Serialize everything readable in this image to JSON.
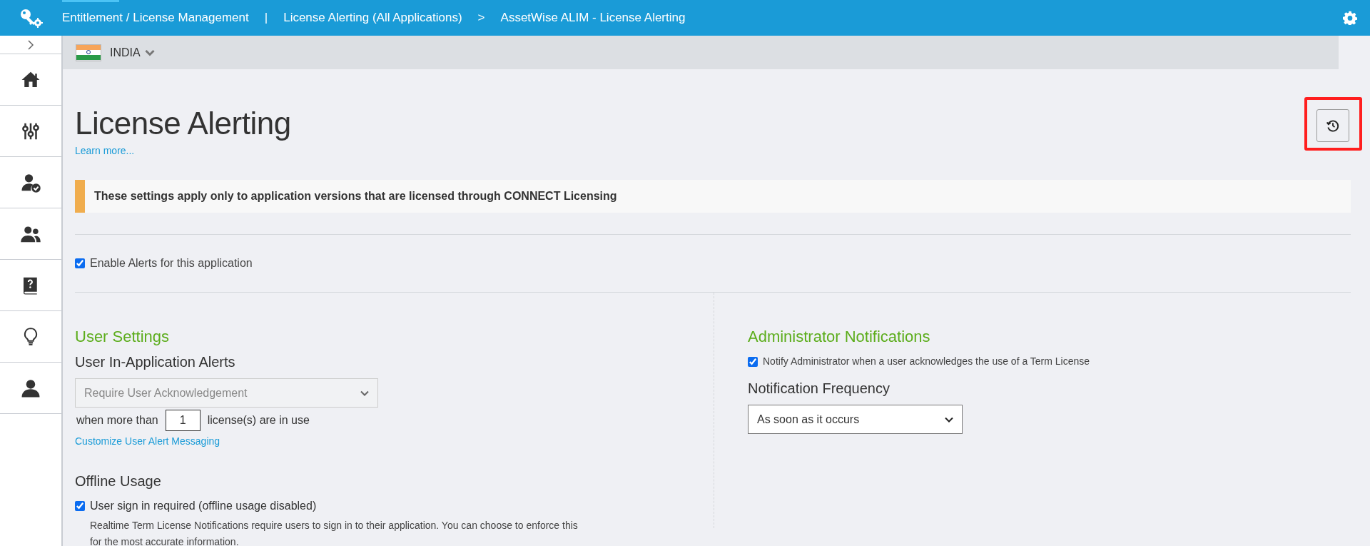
{
  "header": {
    "breadcrumbs": [
      "Entitlement / License Management",
      "License Alerting (All Applications)",
      "AssetWise ALIM - License Alerting"
    ],
    "separators": [
      "|",
      ">"
    ]
  },
  "sidebar": {
    "items": [
      {
        "kind": "home",
        "selected": false
      },
      {
        "kind": "sliders",
        "selected": false
      },
      {
        "kind": "user-check",
        "selected": false
      },
      {
        "kind": "users",
        "selected": false
      },
      {
        "kind": "help-book",
        "selected": false
      },
      {
        "kind": "bulb",
        "selected": false
      },
      {
        "kind": "user",
        "selected": false
      }
    ]
  },
  "country": {
    "name": "INDIA"
  },
  "page": {
    "title": "License Alerting",
    "learn_more": "Learn more...",
    "history_button": {
      "highlighted": true
    },
    "notice": "These settings apply only to application versions that are licensed through CONNECT Licensing",
    "enable_alerts": {
      "label": "Enable Alerts for this application",
      "checked": true
    }
  },
  "user_settings": {
    "heading": "User Settings",
    "subheading": "User In-Application Alerts",
    "alert_mode": {
      "value": "Require User Acknowledgement",
      "disabled": true
    },
    "threshold_prefix": "when more than",
    "threshold_value": "1",
    "threshold_suffix": "license(s) are in use",
    "customize_link": "Customize User Alert Messaging",
    "offline_heading": "Offline Usage",
    "sign_in": {
      "label": "User sign in required (offline usage disabled)",
      "checked": true
    },
    "sign_in_help": "Realtime Term License Notifications require users to sign in to their application. You can choose to enforce this for the most accurate information."
  },
  "admin_notifications": {
    "heading": "Administrator Notifications",
    "notify": {
      "label": "Notify Administrator when a user acknowledges the use of a Term License",
      "checked": true
    },
    "frequency_label": "Notification Frequency",
    "frequency": {
      "value": "As soon as it occurs",
      "disabled": false
    }
  }
}
